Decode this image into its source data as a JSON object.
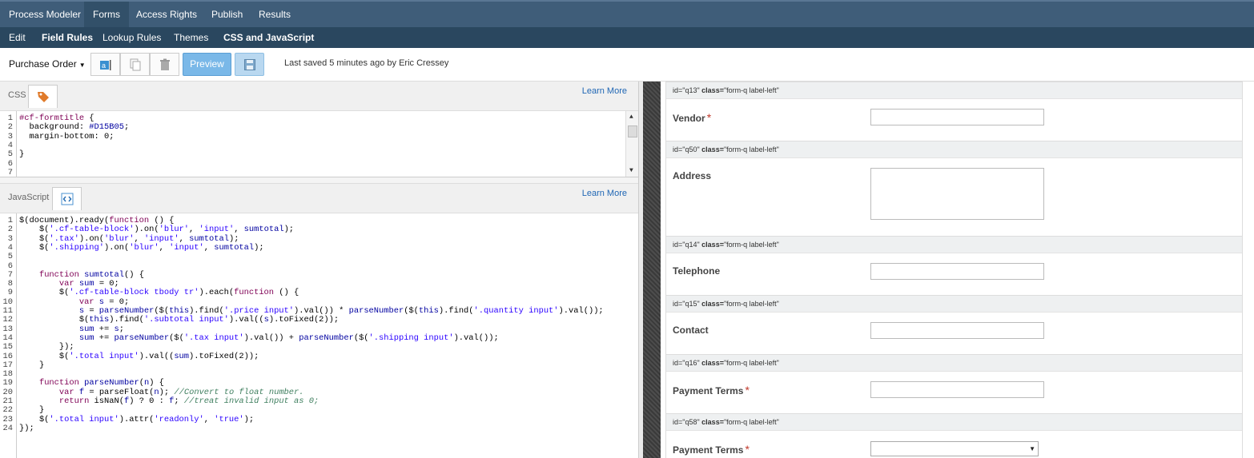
{
  "nav": {
    "primary": [
      "Process Modeler",
      "Forms",
      "Access Rights",
      "Publish",
      "Results"
    ],
    "secondary": [
      "Edit",
      "Field Rules",
      "Lookup Rules",
      "Themes",
      "CSS and JavaScript"
    ]
  },
  "toolbar": {
    "form_name": "Purchase Order",
    "preview_label": "Preview",
    "last_saved": "Last saved 5 minutes ago by Eric Cressey"
  },
  "css_pane": {
    "label": "CSS",
    "learn_more": "Learn More",
    "lines": [
      "#cf-formtitle {",
      "  background: #D15B05;",
      "  margin-bottom: 0;",
      "",
      "}",
      "",
      ""
    ]
  },
  "js_pane": {
    "label": "JavaScript",
    "learn_more": "Learn More",
    "lines": [
      "$(document).ready(function () {",
      "    $('.cf-table-block').on('blur', 'input', sumtotal);",
      "    $('.tax').on('blur', 'input', sumtotal);",
      "    $('.shipping').on('blur', 'input', sumtotal);",
      "",
      "",
      "    function sumtotal() {",
      "        var sum = 0;",
      "        $('.cf-table-block tbody tr').each(function () {",
      "            var s = 0;",
      "            s = parseNumber($(this).find('.price input').val()) * parseNumber($(this).find('.quantity input').val());",
      "            $(this).find('.subtotal input').val((s).toFixed(2));",
      "            sum += s;",
      "            sum += parseNumber($('.tax input').val()) + parseNumber($('.shipping input').val());",
      "        });",
      "        $('.total input').val((sum).toFixed(2));",
      "    }",
      "",
      "    function parseNumber(n) {",
      "        var f = parseFloat(n); //Convert to float number.",
      "        return isNaN(f) ? 0 : f; //treat invalid input as 0;",
      "    }",
      "    $('.total input').attr('readonly', 'true');",
      "});"
    ]
  },
  "form": {
    "questions": [
      {
        "id_text": "id=\"q13\"",
        "class_text": "class=\"form-q label-left\"",
        "label": "Vendor",
        "required": "*",
        "field": "input"
      },
      {
        "id_text": "id=\"q50\"",
        "class_text": "class=\"form-q label-left\"",
        "label": "Address",
        "required": "",
        "field": "textarea"
      },
      {
        "id_text": "id=\"q14\"",
        "class_text": "class=\"form-q label-left\"",
        "label": "Telephone",
        "required": "",
        "field": "input"
      },
      {
        "id_text": "id=\"q15\"",
        "class_text": "class=\"form-q label-left\"",
        "label": "Contact",
        "required": "",
        "field": "input"
      },
      {
        "id_text": "id=\"q16\"",
        "class_text": "class=\"form-q label-left\"",
        "label": "Payment Terms",
        "required": "*",
        "field": "input"
      },
      {
        "id_text": "id=\"q58\"",
        "class_text": "class=\"form-q label-left\"",
        "label": "Payment Terms",
        "required": "*",
        "field": "select"
      }
    ]
  },
  "colors": {
    "nav_primary": "#3f5d79",
    "nav_secondary": "#2a475f",
    "preview_button": "#7ab8e8",
    "link": "#1f66b4",
    "required": "#c0392b"
  }
}
